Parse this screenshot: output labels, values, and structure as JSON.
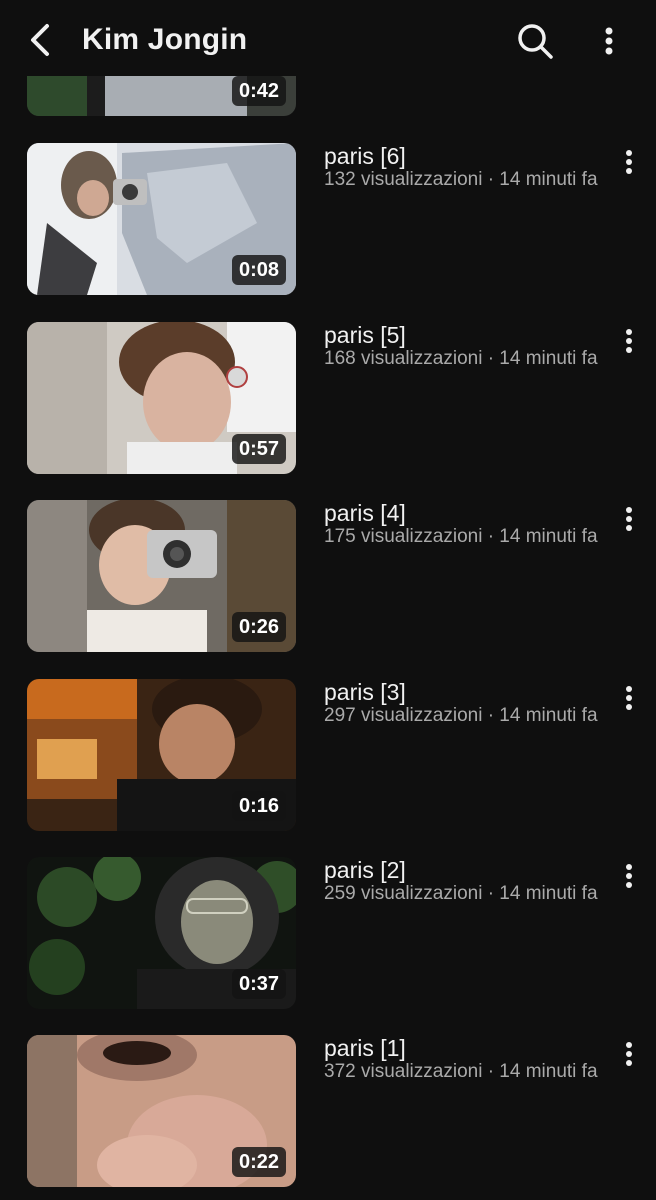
{
  "header": {
    "title": "Kim Jongin",
    "back_icon": "back-arrow-icon",
    "search_icon": "search-icon",
    "menu_icon": "more-vertical-icon"
  },
  "partial_video": {
    "duration": "0:42"
  },
  "videos": [
    {
      "title": "paris [6]",
      "meta": "132 visualizzazioni · 14 minuti fa",
      "duration": "0:08"
    },
    {
      "title": "paris [5]",
      "meta": "168 visualizzazioni · 14 minuti fa",
      "duration": "0:57"
    },
    {
      "title": "paris [4]",
      "meta": "175 visualizzazioni · 14 minuti fa",
      "duration": "0:26"
    },
    {
      "title": "paris [3]",
      "meta": "297 visualizzazioni · 14 minuti fa",
      "duration": "0:16"
    },
    {
      "title": "paris [2]",
      "meta": "259 visualizzazioni · 14 minuti fa",
      "duration": "0:37"
    },
    {
      "title": "paris [1]",
      "meta": "372 visualizzazioni · 14 minuti fa",
      "duration": "0:22"
    }
  ],
  "colors": {
    "background": "#0f0f0f",
    "text_primary": "#f1f1f1",
    "text_secondary": "#aaaaaa"
  }
}
